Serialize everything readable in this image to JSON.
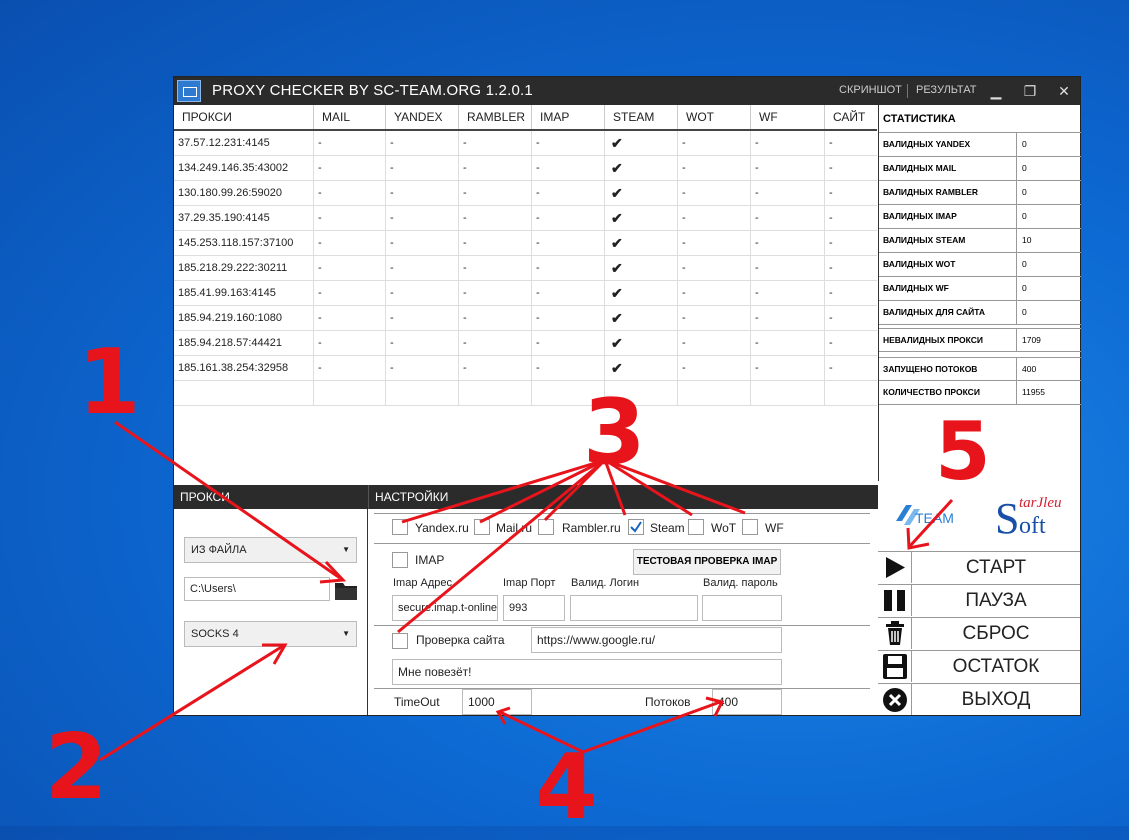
{
  "window": {
    "title": "PROXY CHECKER BY SC-TEAM.ORG 1.2.0.1",
    "screenshot_label": "СКРИНШОТ",
    "result_label": "РЕЗУЛЬТАТ",
    "minimize": "▁",
    "maximize": "❐",
    "close": "✕"
  },
  "grid": {
    "columns": [
      "ПРОКСИ",
      "MAIL",
      "YANDEX",
      "RAMBLER",
      "IMAP",
      "STEAM",
      "WOT",
      "WF",
      "САЙТ"
    ],
    "rows": [
      [
        "37.57.12.231:4145",
        "-",
        "-",
        "-",
        "-",
        "✔",
        "-",
        "-",
        "-"
      ],
      [
        "134.249.146.35:43002",
        "-",
        "-",
        "-",
        "-",
        "✔",
        "-",
        "-",
        "-"
      ],
      [
        "130.180.99.26:59020",
        "-",
        "-",
        "-",
        "-",
        "✔",
        "-",
        "-",
        "-"
      ],
      [
        "37.29.35.190:4145",
        "-",
        "-",
        "-",
        "-",
        "✔",
        "-",
        "-",
        "-"
      ],
      [
        "145.253.118.157:37100",
        "-",
        "-",
        "-",
        "-",
        "✔",
        "-",
        "-",
        "-"
      ],
      [
        "185.218.29.222:30211",
        "-",
        "-",
        "-",
        "-",
        "✔",
        "-",
        "-",
        "-"
      ],
      [
        "185.41.99.163:4145",
        "-",
        "-",
        "-",
        "-",
        "✔",
        "-",
        "-",
        "-"
      ],
      [
        "185.94.219.160:1080",
        "-",
        "-",
        "-",
        "-",
        "✔",
        "-",
        "-",
        "-"
      ],
      [
        "185.94.218.57:44421",
        "-",
        "-",
        "-",
        "-",
        "✔",
        "-",
        "-",
        "-"
      ],
      [
        "185.161.38.254:32958",
        "-",
        "-",
        "-",
        "-",
        "✔",
        "-",
        "-",
        "-"
      ]
    ]
  },
  "stats": {
    "title": "СТАТИСТИКА",
    "items": [
      {
        "label": "ВАЛИДНЫХ YANDEX",
        "value": "0"
      },
      {
        "label": "ВАЛИДНЫХ MAIL",
        "value": "0"
      },
      {
        "label": "ВАЛИДНЫХ RAMBLER",
        "value": "0"
      },
      {
        "label": "ВАЛИДНЫХ IMAP",
        "value": "0"
      },
      {
        "label": "ВАЛИДНЫХ STEAM",
        "value": "10"
      },
      {
        "label": "ВАЛИДНЫХ WOT",
        "value": "0"
      },
      {
        "label": "ВАЛИДНЫХ WF",
        "value": "0"
      },
      {
        "label": "ВАЛИДНЫХ ДЛЯ САЙТА",
        "value": "0"
      },
      {
        "label": "НЕВАЛИДНЫХ ПРОКСИ",
        "value": "1709"
      },
      {
        "label": "ЗАПУЩЕНО ПОТОКОВ",
        "value": "400"
      },
      {
        "label": "КОЛИЧЕСТВО ПРОКСИ",
        "value": "11955"
      }
    ]
  },
  "logos": {
    "left": "TEAM",
    "right_top": "tarJleu",
    "right_bottom": "oft"
  },
  "buttons": {
    "start": "СТАРТ",
    "pause": "ПАУЗА",
    "reset": "СБРОС",
    "remainder": "ОСТАТОК",
    "exit": "ВЫХОД"
  },
  "proxy_panel": {
    "title": "ПРОКСИ",
    "source": "ИЗ ФАЙЛА",
    "path": "C:\\Users\\",
    "type": "SOCKS 4"
  },
  "settings": {
    "title": "НАСТРОЙКИ",
    "services": [
      {
        "label": "Yandex.ru",
        "checked": false
      },
      {
        "label": "Mail.ru",
        "checked": false
      },
      {
        "label": "Rambler.ru",
        "checked": false
      },
      {
        "label": "Steam",
        "checked": true
      },
      {
        "label": "WoT",
        "checked": false
      },
      {
        "label": "WF",
        "checked": false
      }
    ],
    "imap_label": "IMAP",
    "imap_test_button": "ТЕСТОВАЯ ПРОВЕРКА IMAP",
    "imap_address_label": "Imap Адрес",
    "imap_port_label": "Imap Порт",
    "valid_login_label": "Валид. Логин",
    "valid_password_label": "Валид. пароль",
    "imap_address": "secure.imap.t-online",
    "imap_port": "993",
    "valid_login": "",
    "valid_password": "",
    "site_check_label": "Проверка сайта",
    "site_url": "https://www.google.ru/",
    "site_query": "Мне повезёт!",
    "timeout_label": "TimeOut",
    "timeout_value": "1000",
    "threads_label": "Потоков",
    "threads_value": "400"
  },
  "annotations": {
    "n1": "1",
    "n2": "2",
    "n3": "3",
    "n4": "4",
    "n5": "5"
  },
  "colors": {
    "annotation": "#e8141c",
    "titlebar": "#2b2b2b",
    "desktop": "#0d6ad4"
  }
}
